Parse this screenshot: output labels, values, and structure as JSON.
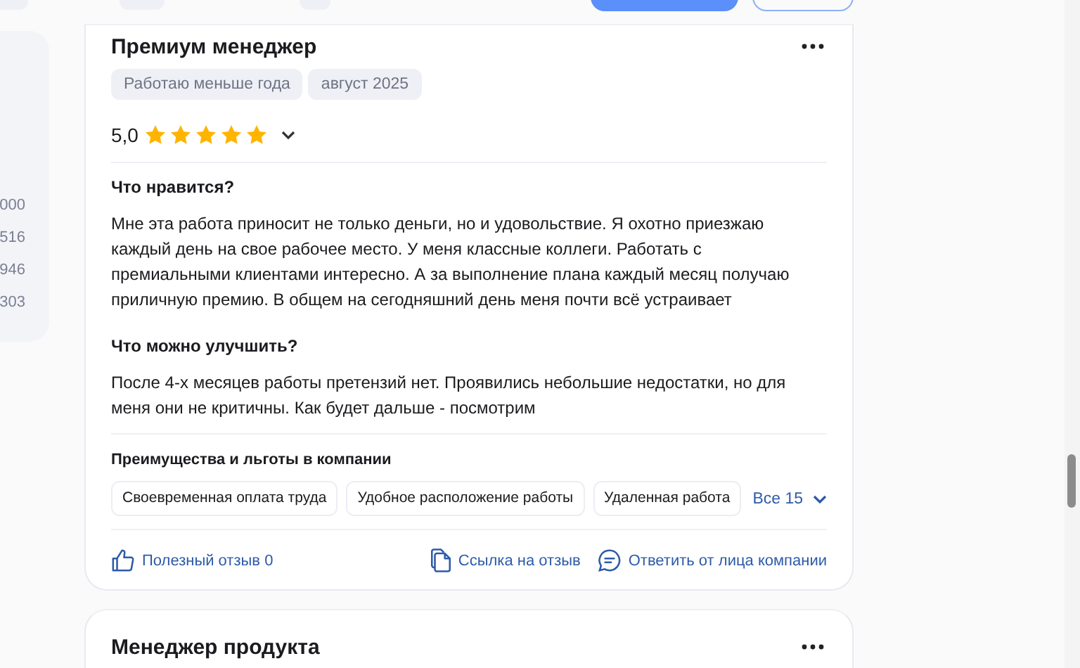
{
  "side_panel": {
    "values": [
      "000",
      "516",
      "946",
      "303"
    ]
  },
  "review": {
    "title": "Премиум менеджер",
    "tags": [
      "Работаю меньше года",
      "август 2025"
    ],
    "rating": "5,0",
    "stars": 5,
    "sections": [
      {
        "heading": "Что нравится?",
        "text": "Мне эта работа приносит не только деньги, но и удовольствие. Я охотно приезжаю каждый день на свое рабочее место. У меня классные коллеги. Работать с премиальными клиентами интересно. А за выполнение плана каждый месяц получаю приличную премию. В общем на сегодняшний день меня почти всё устраивает"
      },
      {
        "heading": "Что можно улучшить?",
        "text": "После 4-х месяцев работы претензий нет. Проявились небольшие недостатки, но для меня они не критичны. Как будет дальше - посмотрим"
      }
    ],
    "benefits": {
      "heading": "Преимущества и льготы в компании",
      "items": [
        "Своевременная оплата труда",
        "Удобное расположение работы",
        "Удаленная работа"
      ],
      "more": "Все 15"
    },
    "actions": {
      "helpful": "Полезный отзыв 0",
      "link": "Ссылка на отзыв",
      "reply": "Ответить от лица компании"
    }
  },
  "next_review": {
    "title": "Менеджер продукта"
  }
}
